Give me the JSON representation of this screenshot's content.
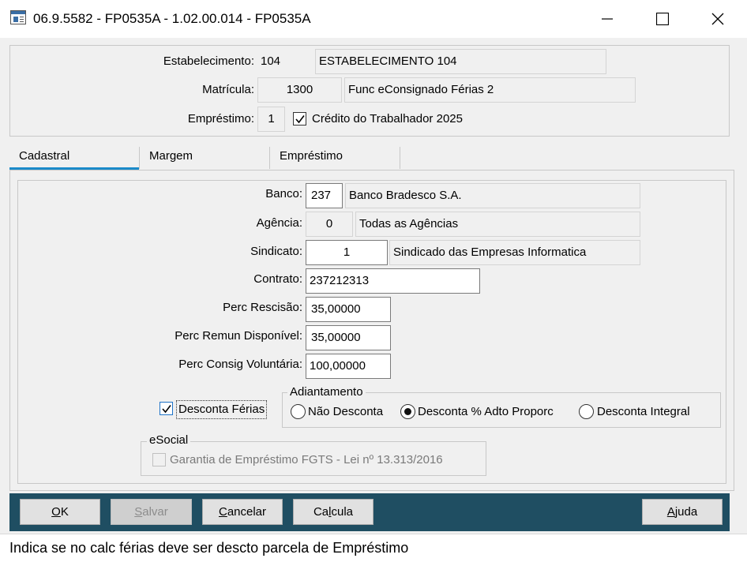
{
  "window": {
    "title": "06.9.5582 - FP0535A - 1.02.00.014 - FP0535A"
  },
  "header": {
    "estabelecimento": {
      "label": "Estabelecimento:",
      "code": "104",
      "name": "ESTABELECIMENTO 104"
    },
    "matricula": {
      "label": "Matrícula:",
      "code": "1300",
      "name": "Func eConsignado Férias 2"
    },
    "emprestimo": {
      "label": "Empréstimo:",
      "code": "1",
      "checkbox_label": "Crédito do Trabalhador 2025",
      "checked": true
    }
  },
  "tabs": [
    {
      "label": "Cadastral",
      "active": true
    },
    {
      "label": "Margem",
      "active": false
    },
    {
      "label": "Empréstimo",
      "active": false
    }
  ],
  "cadastral": {
    "banco": {
      "label": "Banco:",
      "code": "237",
      "name": "Banco Bradesco S.A."
    },
    "agencia": {
      "label": "Agência:",
      "code": "0",
      "name": "Todas as Agências"
    },
    "sindicato": {
      "label": "Sindicato:",
      "code": "1",
      "name": "Sindicado das Empresas Informatica"
    },
    "contrato": {
      "label": "Contrato:",
      "value": "237212313"
    },
    "perc_rescisao": {
      "label": "Perc Rescisão:",
      "value": "35,00000"
    },
    "perc_remun": {
      "label": "Perc Remun Disponível:",
      "value": "35,00000"
    },
    "perc_consig": {
      "label": "Perc Consig Voluntária:",
      "value": "100,00000"
    },
    "desconta_ferias": {
      "label": "Desconta Férias",
      "checked": true
    },
    "adiantamento": {
      "title": "Adiantamento",
      "options": [
        {
          "label": "Não Desconta",
          "selected": false
        },
        {
          "label": "Desconta % Adto Proporc",
          "selected": true
        },
        {
          "label": "Desconta Integral",
          "selected": false
        }
      ]
    },
    "esocial": {
      "title": "eSocial",
      "garantia": {
        "label": "Garantia de Empréstimo FGTS - Lei nº 13.313/2016",
        "checked": false,
        "enabled": false
      }
    }
  },
  "buttons": {
    "ok": {
      "label": "OK",
      "mnemonic": "O",
      "rest": "K"
    },
    "salvar": {
      "label": "Salvar",
      "mnemonic": "S",
      "rest": "alvar",
      "enabled": false
    },
    "cancelar": {
      "label": "Cancelar",
      "mnemonic": "C",
      "rest": "ancelar"
    },
    "calcula": {
      "label": "Calcula",
      "pre": "Ca",
      "mnemonic": "l",
      "rest": "cula"
    },
    "ajuda": {
      "label": "Ajuda",
      "mnemonic": "A",
      "rest": "juda"
    }
  },
  "status": {
    "text": "Indica se no calc férias deve ser descto parcela de Empréstimo"
  },
  "colors": {
    "accent": "#1b8ac9",
    "button_bar": "#1f4e62",
    "background": "#f0f0f0"
  }
}
